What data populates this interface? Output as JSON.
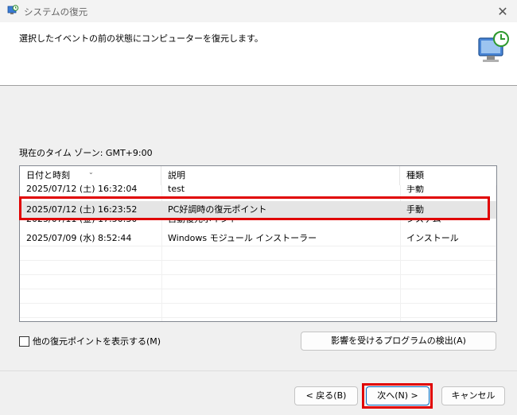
{
  "window": {
    "title": "システムの復元",
    "close_glyph": "✕"
  },
  "header": {
    "instruction": "選択したイベントの前の状態にコンピューターを復元します。"
  },
  "timezone_label": "現在のタイム ゾーン: GMT+9:00",
  "table": {
    "columns": [
      "日付と時刻",
      "説明",
      "種類"
    ],
    "rows": [
      {
        "date": "2025/07/12 (土) 16:32:04",
        "desc": "test",
        "type": "手動"
      },
      {
        "date": "2025/07/12 (土) 16:23:52",
        "desc": "PC好調時の復元ポイント",
        "type": "手動",
        "selected": true
      },
      {
        "date": "2025/07/11 (金) 17:50:30",
        "desc": "自動復元ポイント",
        "type": "システム"
      },
      {
        "date": "2025/07/09 (水) 8:52:44",
        "desc": "Windows モジュール インストーラー",
        "type": "インストール"
      }
    ]
  },
  "show_more_label": "他の復元ポイントを表示する(M)",
  "buttons": {
    "scan": "影響を受けるプログラムの検出(A)",
    "back": "< 戻る(B)",
    "next": "次へ(N) >",
    "cancel": "キャンセル"
  },
  "colors": {
    "highlight": "#e00000",
    "selection": "#e5e5e5",
    "accent": "#0067c0"
  }
}
